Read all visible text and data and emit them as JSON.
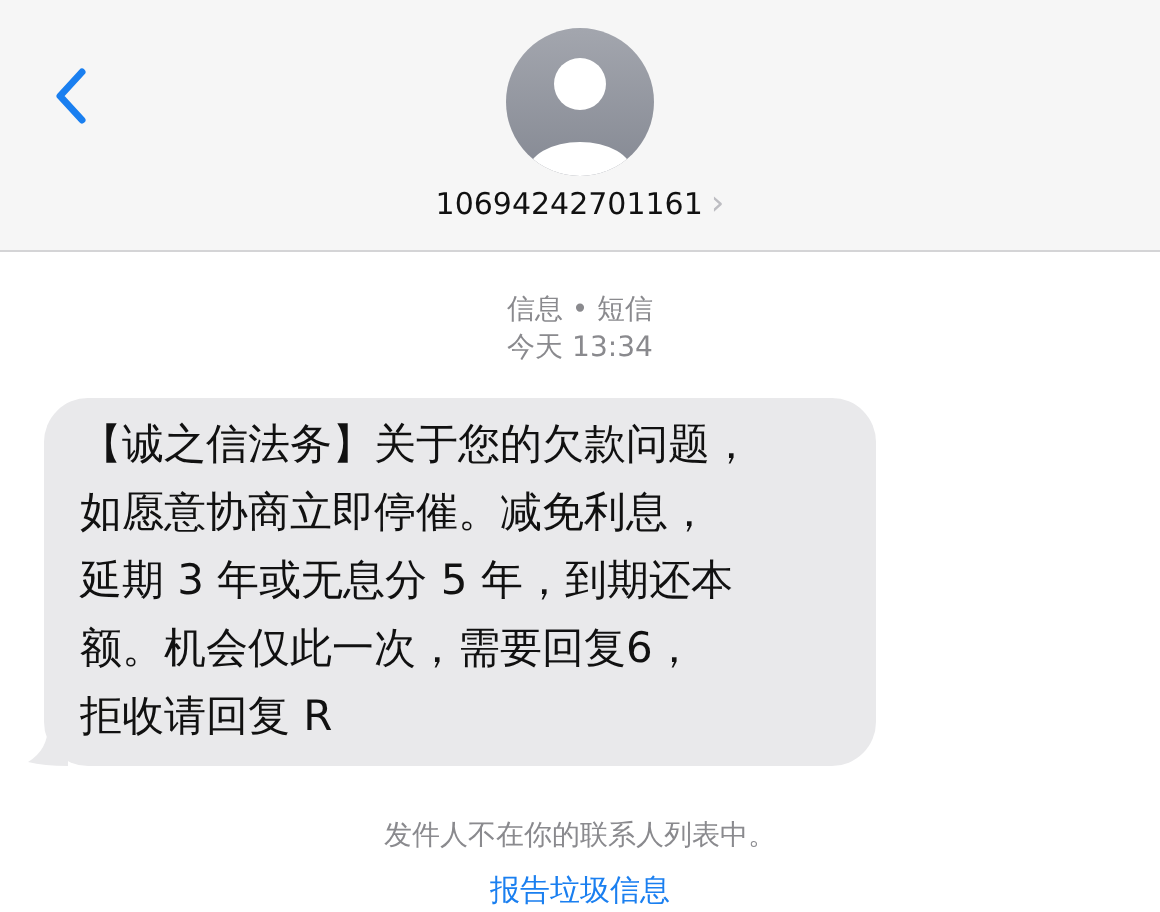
{
  "header": {
    "contact": "10694242701161",
    "chevron": "›"
  },
  "conversation": {
    "service": "信息 • 短信",
    "time": "今天 13:34"
  },
  "message": {
    "lines": [
      "【诚之信法务】关于您的欠款问题，",
      "如愿意协商立即停催。减免利息，",
      "延期 3 年或无息分 5 年，到期还本",
      "额。机会仅此一次，需要回复6，",
      "拒收请回复 R"
    ]
  },
  "footer": {
    "notice": "发件人不在你的联系人列表中。",
    "report_link": "报告垃圾信息"
  }
}
